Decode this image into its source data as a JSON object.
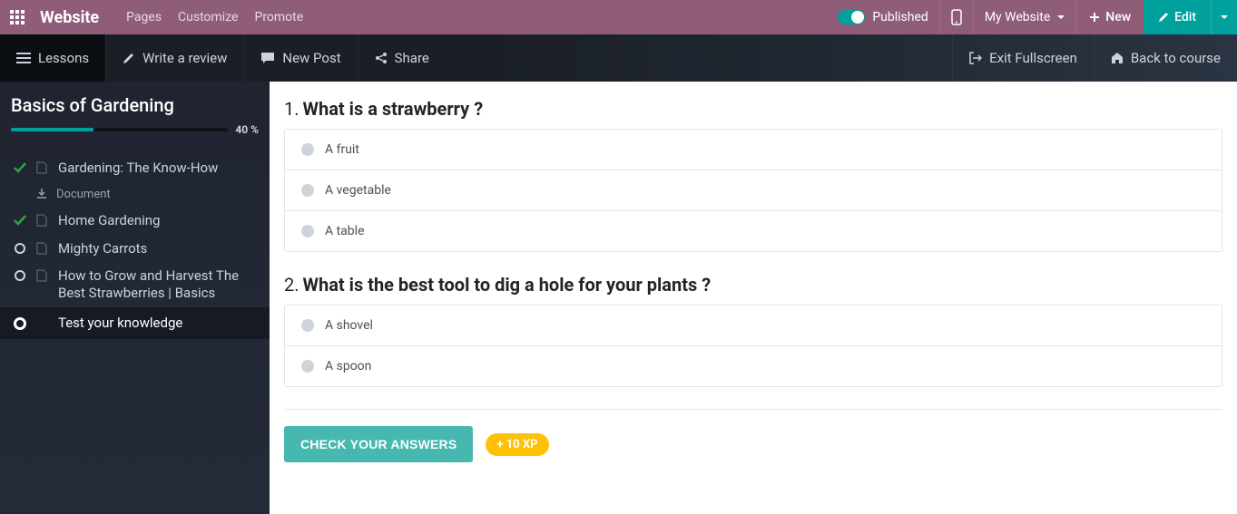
{
  "topbar": {
    "brand": "Website",
    "menu": {
      "pages": "Pages",
      "customize": "Customize",
      "promote": "Promote"
    },
    "published": "Published",
    "my_website": "My Website",
    "new": "New",
    "edit": "Edit"
  },
  "darkbar": {
    "lessons": "Lessons",
    "write_review": "Write a review",
    "new_post": "New Post",
    "share": "Share",
    "exit_fullscreen": "Exit Fullscreen",
    "back_to_course": "Back to course"
  },
  "sidebar": {
    "course_title": "Basics of Gardening",
    "progress_pct": "40 %",
    "lessons": [
      {
        "label": "Gardening: The Know-How",
        "sub_label": "Document"
      },
      {
        "label": "Home Gardening"
      },
      {
        "label": "Mighty Carrots"
      },
      {
        "label": "How to Grow and Harvest The Best Strawberries | Basics"
      },
      {
        "label": "Test your knowledge"
      }
    ]
  },
  "quiz": {
    "questions": [
      {
        "num": "1.",
        "text": "What is a strawberry ?",
        "options": [
          "A fruit",
          "A vegetable",
          "A table"
        ]
      },
      {
        "num": "2.",
        "text": "What is the best tool to dig a hole for your plants ?",
        "options": [
          "A shovel",
          "A spoon"
        ]
      }
    ],
    "check_button": "CHECK YOUR ANSWERS",
    "xp_pill": "+ 10 XP"
  }
}
